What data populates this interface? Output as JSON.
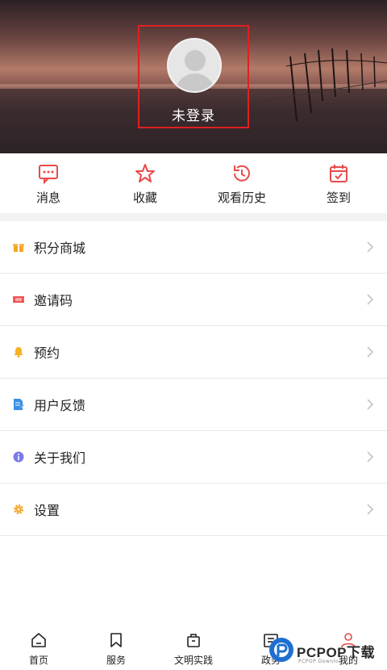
{
  "profile": {
    "login_text": "未登录"
  },
  "quick_actions": [
    {
      "label": "消息",
      "icon": "message-icon"
    },
    {
      "label": "收藏",
      "icon": "star-icon"
    },
    {
      "label": "观看历史",
      "icon": "history-icon"
    },
    {
      "label": "签到",
      "icon": "calendar-check-icon"
    }
  ],
  "menu": [
    {
      "label": "积分商城",
      "icon": "gift-icon",
      "color": "#f5a623"
    },
    {
      "label": "邀请码",
      "icon": "ticket-icon",
      "color": "#f05050"
    },
    {
      "label": "预约",
      "icon": "bell-icon",
      "color": "#f5b323"
    },
    {
      "label": "用户反馈",
      "icon": "feedback-icon",
      "color": "#3a8ee6"
    },
    {
      "label": "关于我们",
      "icon": "info-icon",
      "color": "#7b7be8"
    },
    {
      "label": "设置",
      "icon": "gear-icon",
      "color": "#f5a623"
    }
  ],
  "nav": [
    {
      "label": "首页",
      "icon": "home-icon"
    },
    {
      "label": "服务",
      "icon": "bookmark-icon"
    },
    {
      "label": "文明实践",
      "icon": "bag-icon"
    },
    {
      "label": "政务",
      "icon": "gov-icon"
    },
    {
      "label": "我的",
      "icon": "user-icon",
      "color": "#e84a4a"
    }
  ],
  "watermark": {
    "text": "PCPOP下载",
    "sub": "PCPOP Download"
  },
  "colors": {
    "accent": "#e84a4a",
    "highlight_border": "#e02020"
  }
}
